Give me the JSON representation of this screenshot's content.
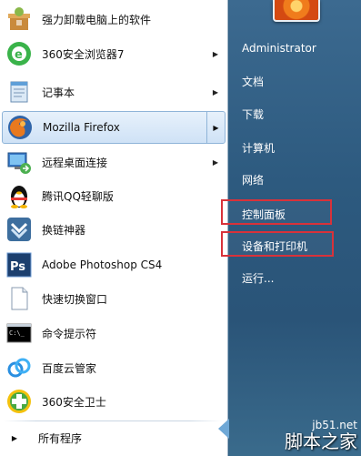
{
  "programs": [
    {
      "label": "强力卸载电脑上的软件",
      "icon": "uninstall-box-icon",
      "has_arrow": false
    },
    {
      "label": "360安全浏览器7",
      "icon": "360-browser-icon",
      "has_arrow": true
    },
    {
      "label": "记事本",
      "icon": "notepad-icon",
      "has_arrow": true
    },
    {
      "label": "Mozilla Firefox",
      "icon": "firefox-icon",
      "has_arrow": true
    },
    {
      "label": "远程桌面连接",
      "icon": "remote-desktop-icon",
      "has_arrow": true
    },
    {
      "label": "腾讯QQ轻聊版",
      "icon": "qq-penguin-icon",
      "has_arrow": false
    },
    {
      "label": "换链神器",
      "icon": "link-tool-icon",
      "has_arrow": false
    },
    {
      "label": "Adobe Photoshop CS4",
      "icon": "photoshop-icon",
      "has_arrow": false
    },
    {
      "label": "快速切换窗口",
      "icon": "document-icon",
      "has_arrow": false
    },
    {
      "label": "命令提示符",
      "icon": "cmd-icon",
      "has_arrow": false
    },
    {
      "label": "百度云管家",
      "icon": "baidu-cloud-icon",
      "has_arrow": false
    },
    {
      "label": "360安全卫士",
      "icon": "360-safe-icon",
      "has_arrow": false
    }
  ],
  "all_programs": {
    "label": "所有程序"
  },
  "right_items": {
    "user": "Administrator",
    "documents": "文档",
    "downloads": "下载",
    "computer": "计算机",
    "network": "网络",
    "control_panel": "控制面板",
    "devices_printers": "设备和打印机",
    "run": "运行..."
  },
  "highlight_color": "#d9323a",
  "watermark": {
    "line1": "jb51.net",
    "line2": "脚本之家"
  }
}
